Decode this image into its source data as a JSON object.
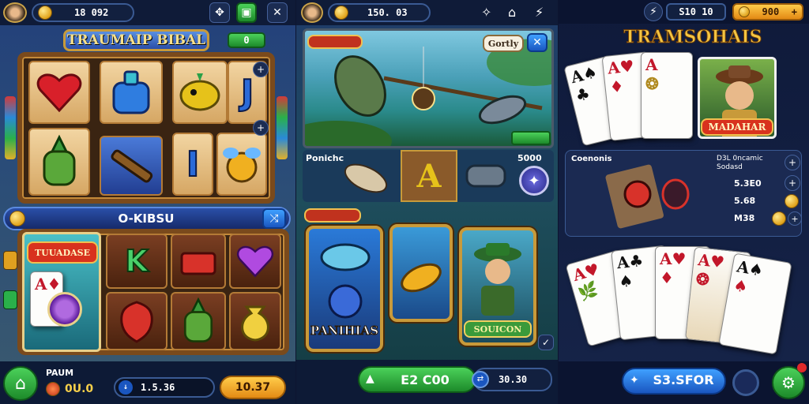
{
  "panel1": {
    "top_bar": {
      "currency_value": "18 092"
    },
    "title": "TRAUMAIP BIBAL",
    "badge_value": "0",
    "slot_symbols_top": [
      "heart",
      "potion",
      "fish",
      "J",
      "bomb",
      "telescope",
      "I",
      "bee"
    ],
    "slot_letters": {
      "j": "J",
      "i": "I",
      "k": "K"
    },
    "bonus_bar": "O-KIBSU",
    "featured_card_title": "TUUADASE",
    "bottom": {
      "label": "PAUM",
      "coin_value": "0U.0",
      "bet_value": "1.5.36",
      "win_button": "10.37"
    }
  },
  "panel2": {
    "top_bar": {
      "currency_value": "150. 03"
    },
    "scene_tag": "",
    "scene_tag_right": "Gortly",
    "catch_label": "",
    "items_label": "Ponichc",
    "items_value": "5000",
    "section_tag": "",
    "card_fish_title": "PANIHIAS",
    "card_hero_title": "SOUICON",
    "bottom": {
      "play_label": "",
      "play_value": "E2 C00",
      "total_value": "30.30"
    }
  },
  "panel3": {
    "top_bar": {
      "left_value": "S10 10",
      "right_value": "900"
    },
    "title": "TRAMSOHAIS",
    "hero_card_title": "MADAHAR",
    "info_title": "Coenonis",
    "info_right_title": "D3L 0ncamic",
    "info_right_sub": "Sodasd",
    "values": [
      "5.3E0",
      "5.68",
      "M38"
    ],
    "bottom": {
      "play_label": "",
      "play_value": "S3.SFOR"
    }
  },
  "colors": {
    "gold": "#f4c542",
    "green": "#2fb04a",
    "blue": "#1f6fe0",
    "wood": "#7a4a1c"
  }
}
